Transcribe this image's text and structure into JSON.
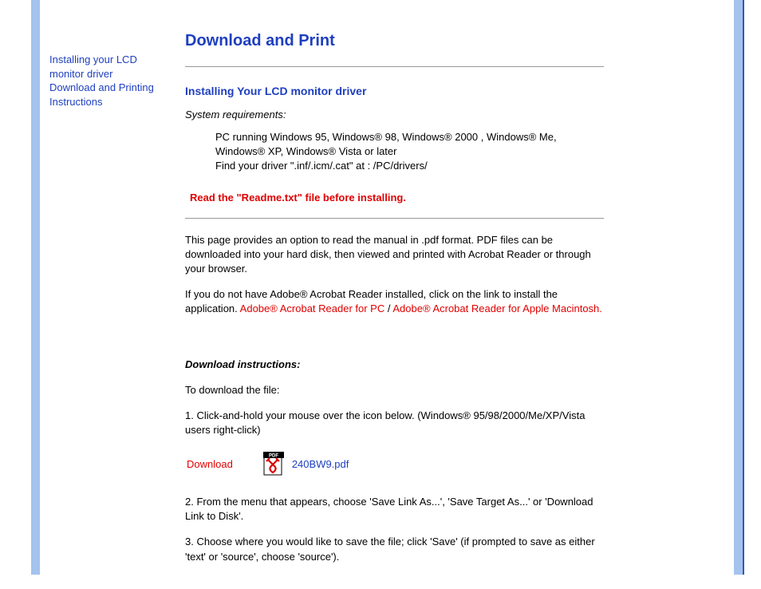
{
  "sidebar": {
    "link1": "Installing your LCD monitor driver",
    "link2": "Download and Printing Instructions"
  },
  "page": {
    "title": "Download and Print",
    "section1": {
      "heading": "Installing Your LCD monitor driver",
      "reqLabel": "System requirements:",
      "req1": "PC running Windows 95, Windows® 98, Windows® 2000 , Windows® Me, Windows® XP, Windows® Vista or later",
      "req2": "Find your driver \".inf/.icm/.cat\" at : /PC/drivers/",
      "warning": "Read the \"Readme.txt\" file before installing."
    },
    "section2": {
      "para1": "This page provides an option to read the manual in .pdf format. PDF files can be downloaded into your hard disk, then viewed and printed with Acrobat Reader or through your browser.",
      "para2a": "If you do not have Adobe® Acrobat Reader installed, click on the link to install the application. ",
      "linkPC": "Adobe® Acrobat Reader for PC",
      "sep": " / ",
      "linkMac": "Adobe® Acrobat Reader for Apple Macintosh."
    },
    "download": {
      "heading": "Download instructions:",
      "intro": "To download the file:",
      "step1": "1. Click-and-hold your mouse over the icon below. (Windows® 95/98/2000/Me/XP/Vista users right-click)",
      "label": "Download",
      "filename": "240BW9.pdf",
      "step2": "2. From the menu that appears, choose 'Save Link As...', 'Save Target As...' or 'Download Link to Disk'.",
      "step3": "3. Choose where you would like to save the file; click 'Save' (if prompted to save as either 'text' or 'source', choose 'source')."
    }
  }
}
